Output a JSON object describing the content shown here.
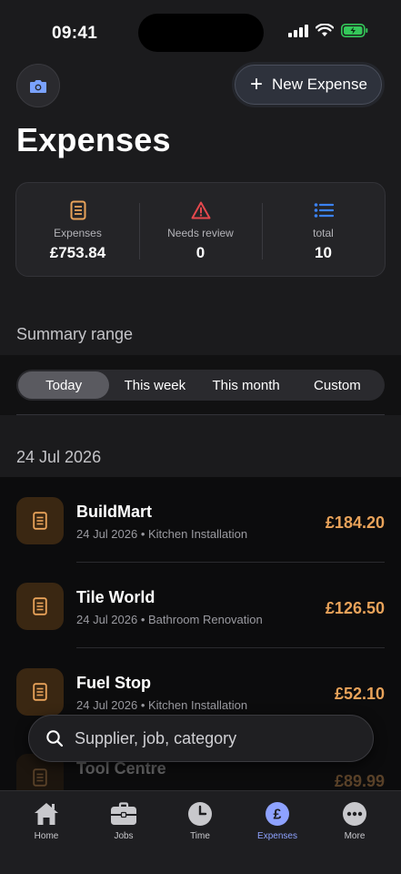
{
  "status_bar": {
    "time": "09:41"
  },
  "header": {
    "title": "Expenses",
    "new_expense_label": "New Expense",
    "camera_icon": "camera-icon"
  },
  "stats": {
    "expenses": {
      "label": "Expenses",
      "value": "£753.84",
      "icon": "receipt-icon",
      "color": "#e9a35a"
    },
    "review": {
      "label": "Needs review",
      "value": "0",
      "icon": "warning-icon",
      "color": "#e5484d"
    },
    "total": {
      "label": "total",
      "value": "10",
      "icon": "list-icon",
      "color": "#3b82f6"
    }
  },
  "summary": {
    "label": "Summary range",
    "options": [
      "Today",
      "This week",
      "This month",
      "Custom"
    ],
    "selected": "Today"
  },
  "date_group": "24 Jul 2026",
  "expenses": [
    {
      "supplier": "BuildMart",
      "subtitle": "24 Jul 2026 • Kitchen Installation",
      "amount": "£184.20"
    },
    {
      "supplier": "Tile World",
      "subtitle": "24 Jul 2026 • Bathroom Renovation",
      "amount": "£126.50"
    },
    {
      "supplier": "Fuel Stop",
      "subtitle": "24 Jul 2026 • Kitchen Installation",
      "amount": "£52.10"
    },
    {
      "supplier": "Tool Centre",
      "subtitle": "",
      "amount": "£89.99"
    }
  ],
  "search": {
    "placeholder": "Supplier, job, category"
  },
  "tabs": [
    {
      "label": "Home",
      "icon": "home-icon"
    },
    {
      "label": "Jobs",
      "icon": "briefcase-icon"
    },
    {
      "label": "Time",
      "icon": "clock-icon"
    },
    {
      "label": "Expenses",
      "icon": "pound-icon",
      "active": true
    },
    {
      "label": "More",
      "icon": "more-icon"
    }
  ],
  "colors": {
    "accent": "#8ea2ff",
    "amount": "#e9a35a",
    "background": "#1b1b1d"
  }
}
